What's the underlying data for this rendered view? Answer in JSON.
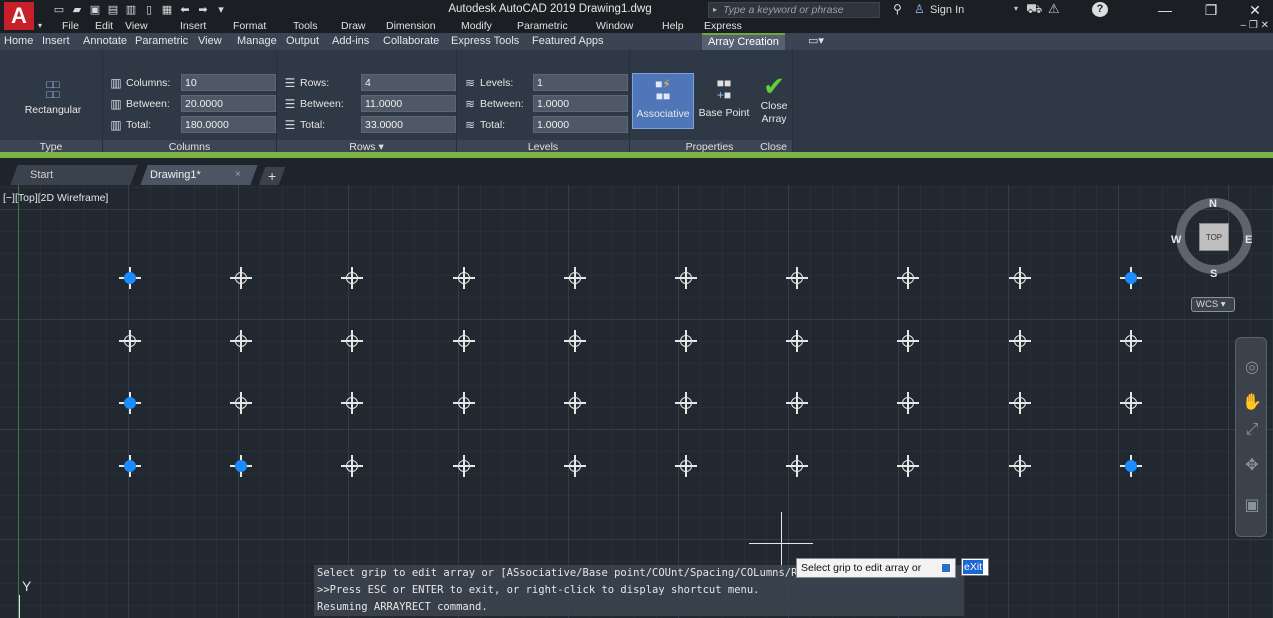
{
  "titlebar": {
    "app_logo": "A",
    "title": "Autodesk AutoCAD 2019   Drawing1.dwg",
    "search_placeholder": "Type a keyword or phrase",
    "sign_in": "Sign In",
    "qat_icons": [
      "new-icon",
      "open-icon",
      "save-icon",
      "saveas-icon",
      "cloud-icon",
      "print-icon",
      "plot-icon",
      "undo-icon",
      "redo-icon",
      "dropdown-icon"
    ]
  },
  "menubar": {
    "items": [
      "File",
      "Edit",
      "View",
      "Insert",
      "Format",
      "Tools",
      "Draw",
      "Dimension",
      "Modify",
      "Parametric",
      "Window",
      "Help",
      "Express"
    ]
  },
  "ribbon_tabs": {
    "items": [
      "Home",
      "Insert",
      "Annotate",
      "Parametric",
      "View",
      "Manage",
      "Output",
      "Add-ins",
      "Collaborate",
      "Express Tools",
      "Featured Apps",
      "Array Creation"
    ],
    "active": "Array Creation"
  },
  "ribbon": {
    "type_panel": {
      "button": "Rectangular",
      "label": "Type"
    },
    "columns_panel": {
      "label": "Columns",
      "columns_label": "Columns:",
      "columns_value": "10",
      "between_label": "Between:",
      "between_value": "20.0000",
      "total_label": "Total:",
      "total_value": "180.0000"
    },
    "rows_panel": {
      "label": "Rows ▾",
      "rows_label": "Rows:",
      "rows_value": "4",
      "between_label": "Between:",
      "between_value": "11.0000",
      "total_label": "Total:",
      "total_value": "33.0000"
    },
    "levels_panel": {
      "label": "Levels",
      "levels_label": "Levels:",
      "levels_value": "1",
      "between_label": "Between:",
      "between_value": "1.0000",
      "total_label": "Total:",
      "total_value": "1.0000"
    },
    "properties_panel": {
      "label": "Properties",
      "associative": "Associative",
      "base_point": "Base Point"
    },
    "close_panel": {
      "label": "Close",
      "close_line1": "Close",
      "close_line2": "Array"
    }
  },
  "filetabs": {
    "start": "Start",
    "drawing": "Drawing1*",
    "close_glyph": "×",
    "add_glyph": "+"
  },
  "canvas": {
    "viewport_label": "[−][Top][2D Wireframe]",
    "ucs_label": "Y",
    "array_columns": 10,
    "array_rows": 4,
    "grips": [
      [
        0,
        0
      ],
      [
        9,
        0
      ],
      [
        0,
        2
      ],
      [
        0,
        3
      ],
      [
        1,
        3
      ],
      [
        9,
        3
      ]
    ]
  },
  "viewcube": {
    "north": "N",
    "south": "S",
    "east": "E",
    "west": "W",
    "top": "TOP",
    "wcs": "WCS ▾"
  },
  "dynamic_input": {
    "prompt": "Select grip to edit array or",
    "exit": "eXit"
  },
  "command_history": [
    "Select grip to edit array or [ASsociative/Base point/COUnt/Spacing/COLumns/Rows/Levels/eXit]",
    ">>Press ESC or ENTER to exit, or right-click to display shortcut menu.",
    "Resuming ARRAYRECT command."
  ]
}
